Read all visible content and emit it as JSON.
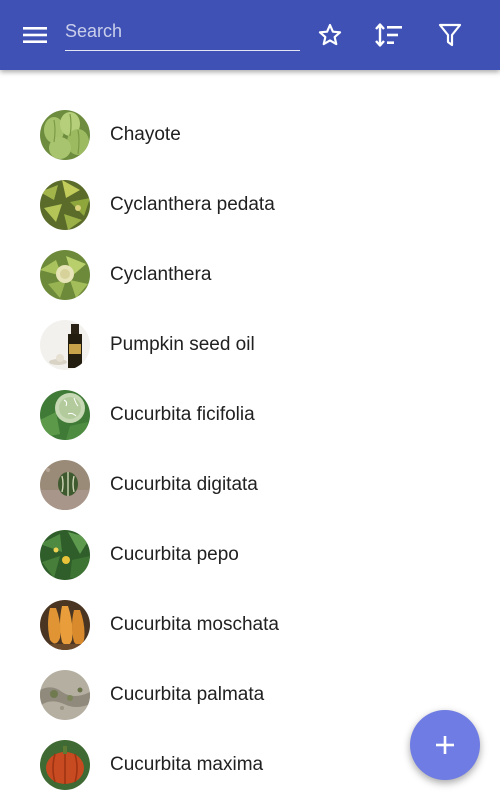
{
  "appbar": {
    "background_color": "#3f51b5",
    "menu_icon": "hamburger-menu-icon",
    "search": {
      "placeholder": "Search",
      "value": ""
    },
    "actions": [
      {
        "icon": "star-icon"
      },
      {
        "icon": "sort-icon"
      },
      {
        "icon": "filter-icon"
      }
    ]
  },
  "list": {
    "items": [
      {
        "label": "Chayote",
        "thumbnail": "chayote-thumbnail"
      },
      {
        "label": "Cyclanthera pedata",
        "thumbnail": "cyclanthera-pedata-thumbnail"
      },
      {
        "label": "Cyclanthera",
        "thumbnail": "cyclanthera-thumbnail"
      },
      {
        "label": "Pumpkin seed oil",
        "thumbnail": "pumpkin-seed-oil-thumbnail"
      },
      {
        "label": "Cucurbita ficifolia",
        "thumbnail": "cucurbita-ficifolia-thumbnail"
      },
      {
        "label": "Cucurbita digitata",
        "thumbnail": "cucurbita-digitata-thumbnail"
      },
      {
        "label": "Cucurbita pepo",
        "thumbnail": "cucurbita-pepo-thumbnail"
      },
      {
        "label": "Cucurbita moschata",
        "thumbnail": "cucurbita-moschata-thumbnail"
      },
      {
        "label": "Cucurbita palmata",
        "thumbnail": "cucurbita-palmata-thumbnail"
      },
      {
        "label": "Cucurbita maxima",
        "thumbnail": "cucurbita-maxima-thumbnail"
      }
    ]
  },
  "fab": {
    "icon": "plus-icon",
    "color": "#6f7ce3"
  }
}
